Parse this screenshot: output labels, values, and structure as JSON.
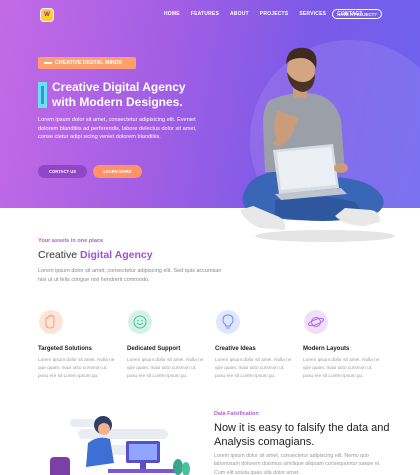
{
  "brand": {
    "logo_text": "W"
  },
  "nav": {
    "items": [
      "HOME",
      "FEATURES",
      "ABOUT",
      "PROJECTS",
      "SERVICES",
      "CONTACT"
    ],
    "cta": "HAVE A PROJECT?"
  },
  "hero": {
    "badge": "CREATIVE DIGITAL MINDS",
    "title_line1": "Creative Digital Agency",
    "title_line2": "with Modern Designes.",
    "description": "Lorem ipsum dolor sit amet, consectetur adipisicing elit. Eveniet dolorem blanditiis ad perferendis, labore delectus dolor sit amet, conse ctetur adipi sicing veniet dolorem blanditiis.",
    "btn_contact": "CONTACT US",
    "btn_learn": "LEARN MORE"
  },
  "about": {
    "eyebrow": "Your assets in one place",
    "title_plain": "Creative ",
    "title_highlight": "Digital Agency",
    "description": "Lorem ipsum dolor sit amet, consectetur adipiscing elit. Sed quis accumsan nisi ut ut felis congue nisl hendrerit commodo."
  },
  "features": [
    {
      "title": "Targeted Solutions",
      "text": "Lorem ipsum dolor sit amet. Nulla ne que quam, maxi utso cursmon ut, posu ere sit Lorem ipsum qu.",
      "icon": "hand-icon",
      "color": "#f8a07a"
    },
    {
      "title": "Dedicated Support",
      "text": "Lorem ipsum dolor sit amet. Nulla ne que quam, maxi utso cursmon ut, posu ere sit Lorem ipsum qu.",
      "icon": "support-icon",
      "color": "#49c29a"
    },
    {
      "title": "Creative Ideas",
      "text": "Lorem ipsum dolor sit amet. Nulla ne que quam, maxi utso cursmon ut, posu ere sit Lorem ipsum qu.",
      "icon": "bulb-icon",
      "color": "#6d8ef5"
    },
    {
      "title": "Modern Layouts",
      "text": "Lorem ipsum dolor sit amet. Nulla ne que quam, maxi utso cursmon ut, posu ere sit Lorem ipsum qu.",
      "icon": "planet-icon",
      "color": "#b06be0"
    }
  ],
  "data_section": {
    "eyebrow": "Data Falsification",
    "title": "Now it is easy to falsify the data and Analysis comagians.",
    "description": "Lorem ipsum dolor sit amet, consectetur adipiscing elit. Nemo quo laboriosam dolorem duismus similique aliquam consequuntur saepe et. Cum elit soluta quas ulla dolor amet."
  }
}
